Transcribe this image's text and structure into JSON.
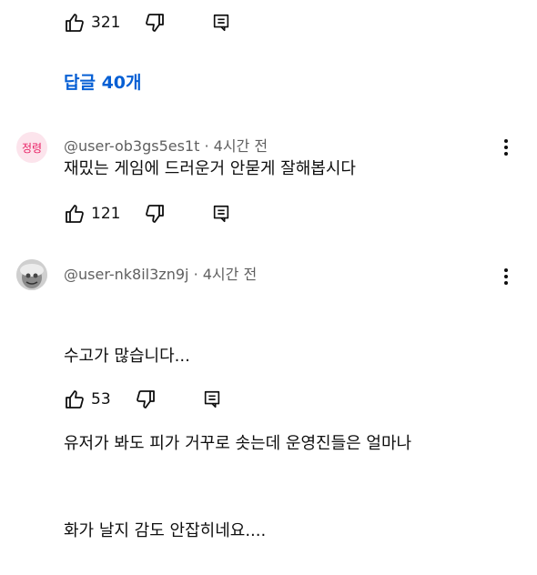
{
  "top_comment": {
    "like_count": "321"
  },
  "replies_link": "답글 40개",
  "comments": [
    {
      "avatar_text": "정령",
      "handle": "@user-ob3gs5es1t",
      "time": "4시간 전",
      "text": "재밌는 게임에 드러운거 안묻게 잘해봅시다",
      "like_count": "121"
    },
    {
      "handle": "@user-nk8il3zn9j",
      "time": "4시간 전",
      "text_lines": [
        "수고가 많습니다...",
        "유저가 봐도 피가 거꾸로 솟는데 운영진들은 얼마나",
        "화가 날지 감도 안잡히네요...."
      ],
      "like_count": "53"
    }
  ],
  "colors": {
    "link": "#065fd4",
    "text": "#0f0f0f",
    "meta": "#606060",
    "avatar_bg": "#fce4ec",
    "avatar_fg": "#e91e63"
  }
}
